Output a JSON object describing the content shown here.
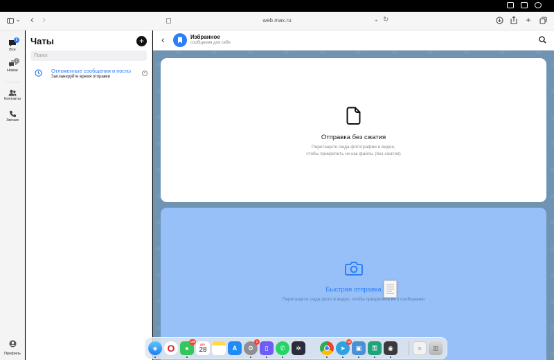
{
  "browser": {
    "url": "web.max.ru"
  },
  "nav": {
    "items": [
      {
        "label": "Все",
        "badge": "8"
      },
      {
        "label": "Новое",
        "badge": "1"
      },
      {
        "label": "Контакты"
      },
      {
        "label": "Звонки"
      }
    ],
    "profile_label": "Профиль"
  },
  "chats": {
    "title": "Чаты",
    "new_chat": "+",
    "search_placeholder": "Поиск",
    "items": [
      {
        "title": "Отложенные сообщения и посты",
        "subtitle": "Запланируйте время отправки"
      }
    ]
  },
  "chat": {
    "title": "Избранное",
    "subtitle": "сообщения для себя",
    "drop_plain": {
      "title": "Отправка без сжатия",
      "desc_line1": "Перетащите сюда фотографии и видео,",
      "desc_line2": "чтобы прикрепить их как файлы (без сжатия)"
    },
    "drop_quick": {
      "title": "Быстрая отправка",
      "desc": "Перетащите сюда фото и видео, чтобы прикрепить их к сообщению"
    }
  },
  "dock": {
    "calendar_day": "28",
    "calendar_month": "ДЕК.",
    "badges": {
      "messages": "156",
      "settings": "1",
      "telegram": "18"
    }
  },
  "colors": {
    "accent": "#2d7ff9",
    "chat_background": "#6f93b3",
    "quick_drop": "#97bff8"
  }
}
